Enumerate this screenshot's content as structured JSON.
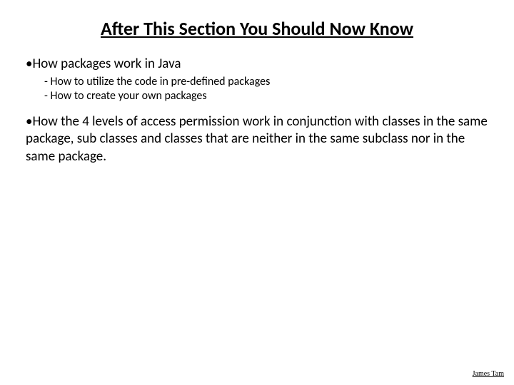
{
  "title": "After This Section You Should Now Know",
  "bullets": {
    "item1": {
      "text": "How packages work in Java",
      "sub1": "How to utilize the code in pre-defined packages",
      "sub2": "How to create your own packages"
    },
    "item2": {
      "text": "How the 4 levels of access permission work in conjunction with classes in the same package, sub classes and classes that are neither in the same subclass nor in the same package."
    }
  },
  "footer": "James Tam",
  "glyphs": {
    "bullet": "•",
    "dash": "-"
  }
}
